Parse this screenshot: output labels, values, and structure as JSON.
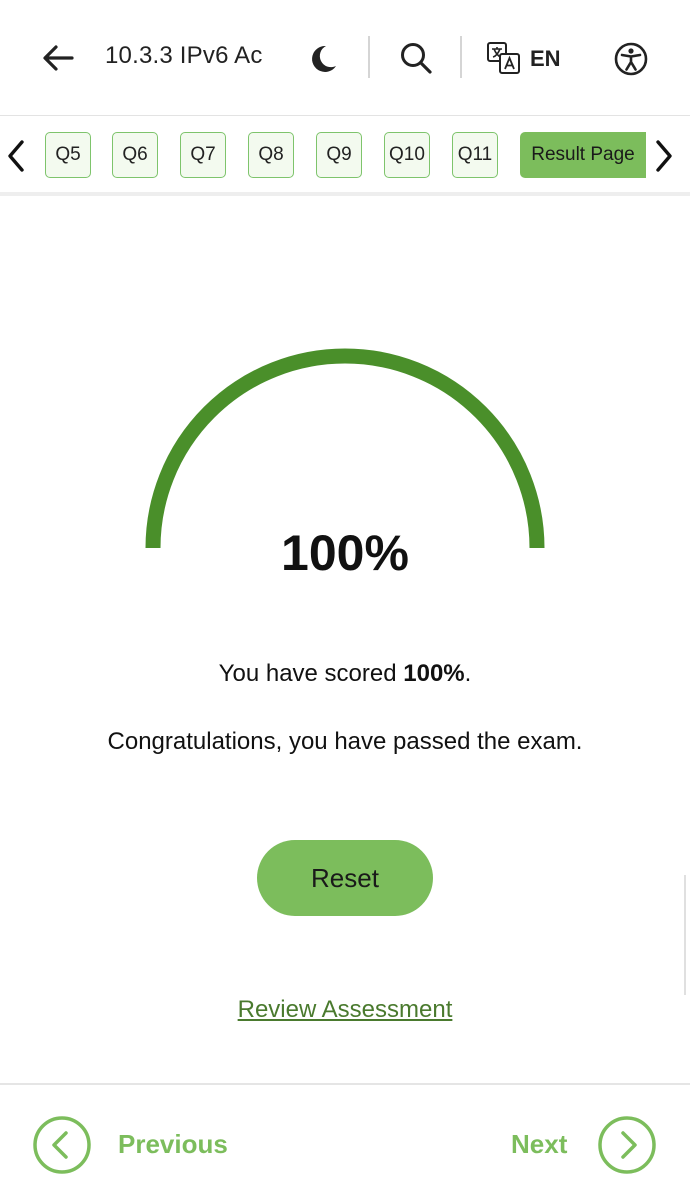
{
  "header": {
    "title": "10.3.3 IPv6 Ac",
    "language": "EN",
    "icons": [
      "back-arrow-icon",
      "moon-icon",
      "search-icon",
      "translate-icon",
      "accessibility-icon"
    ]
  },
  "question_nav": {
    "items": [
      "Q5",
      "Q6",
      "Q7",
      "Q8",
      "Q9",
      "Q10",
      "Q11"
    ],
    "active_label": "Result Page"
  },
  "result": {
    "percent_display": "100%",
    "percent_value": 100,
    "score_prefix": "You have scored ",
    "score_value": "100%",
    "score_suffix": ".",
    "message": "Congratulations, you have passed the exam.",
    "reset_label": "Reset",
    "review_label": "Review Assessment"
  },
  "footer": {
    "previous_label": "Previous",
    "next_label": "Next"
  },
  "colors": {
    "accent": "#7cbd5c",
    "gauge": "#4a8f2a",
    "link": "#4a7a2e"
  }
}
